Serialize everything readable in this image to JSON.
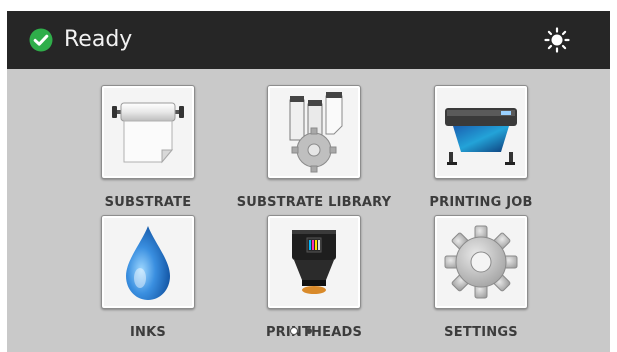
{
  "status": {
    "text": "Ready",
    "icon": "check-circle-icon",
    "color": "#2fae4a"
  },
  "header": {
    "brightness_icon": "brightness-icon"
  },
  "tiles": [
    {
      "label": "SUBSTRATE",
      "icon": "substrate-roll-icon"
    },
    {
      "label": "SUBSTRATE LIBRARY",
      "icon": "substrate-library-icon"
    },
    {
      "label": "PRINTING JOB",
      "icon": "printer-icon"
    },
    {
      "label": "INKS",
      "icon": "ink-drop-icon"
    },
    {
      "label": "PRINTHEADS",
      "icon": "printhead-icon"
    },
    {
      "label": "SETTINGS",
      "icon": "gear-icon"
    }
  ],
  "pagination": {
    "current": 1,
    "total": 2
  },
  "colors": {
    "header_bg": "#262626",
    "screen_bg": "#c9c9c9",
    "ink_drop": "#2a7fd6"
  }
}
